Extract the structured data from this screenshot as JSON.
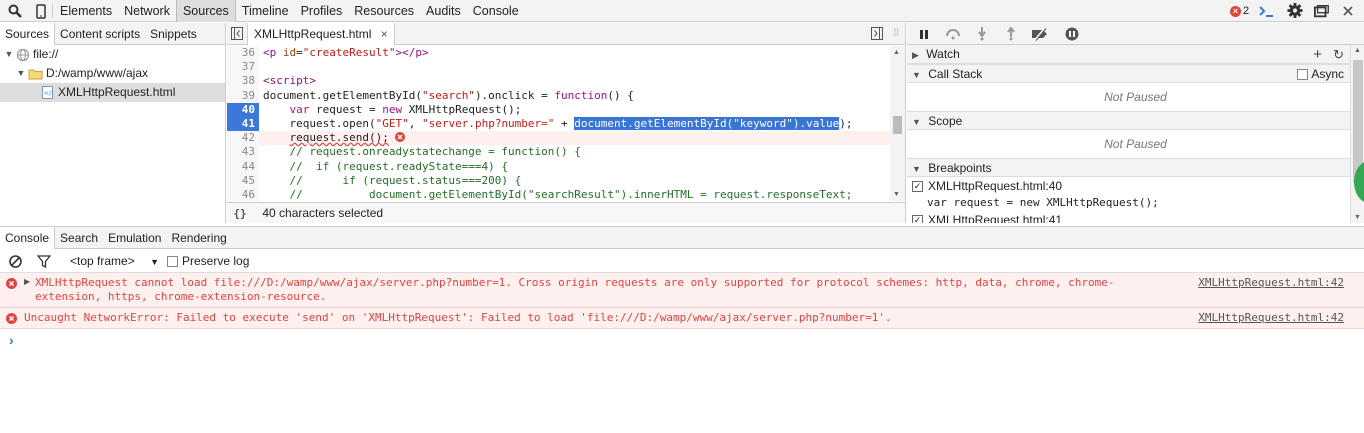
{
  "toolbar": {
    "tabs": [
      "Elements",
      "Network",
      "Sources",
      "Timeline",
      "Profiles",
      "Resources",
      "Audits",
      "Console"
    ],
    "error_count": "2"
  },
  "navigator": {
    "tabs": [
      "Sources",
      "Content scripts",
      "Snippets"
    ],
    "tree": [
      "file://",
      "D:/wamp/www/ajax",
      "XMLHttpRequest.html"
    ]
  },
  "editor": {
    "file_tab": "XMLHttpRequest.html",
    "status": "40 characters selected",
    "status_icon": "{}",
    "lines": [
      {
        "n": "36",
        "text": "<p id=\"createResult\"></p>"
      },
      {
        "n": "37",
        "text": ""
      },
      {
        "n": "38",
        "text": "<script>"
      },
      {
        "n": "39",
        "text": "document.getElementById(\"search\").onclick = function() {"
      },
      {
        "n": "40",
        "text": "    var request = new XMLHttpRequest();"
      },
      {
        "n": "41",
        "text": "    request.open(\"GET\", \"server.php?number=\" + document.getElementById(\"keyword\").value);"
      },
      {
        "n": "42",
        "text": "    request.send();"
      },
      {
        "n": "43",
        "text": "    // request.onreadystatechange = function() {"
      },
      {
        "n": "44",
        "text": "    //  if (request.readyState===4) {"
      },
      {
        "n": "45",
        "text": "    //      if (request.status===200) {"
      },
      {
        "n": "46",
        "text": "    //          document.getElementById(\"searchResult\").innerHTML = request.responseText;"
      }
    ]
  },
  "debugger": {
    "watch": "Watch",
    "call_stack": "Call Stack",
    "async": "Async",
    "not_paused": "Not Paused",
    "scope": "Scope",
    "breakpoints": "Breakpoints",
    "bp_file": "XMLHttpRequest.html:40",
    "bp_code": "var request = new XMLHttpRequest();",
    "bp_file2": "XMLHttpRequest.html:41"
  },
  "drawer": {
    "tabs": [
      "Console",
      "Search",
      "Emulation",
      "Rendering"
    ],
    "frame": "<top frame>",
    "preserve_log": "Preserve log",
    "messages": [
      {
        "text": "XMLHttpRequest cannot load file:///D:/wamp/www/ajax/server.php?number=1. Cross origin requests are only supported for protocol schemes: http, data, chrome, chrome-extension, https, chrome-extension-resource.",
        "link": "XMLHttpRequest.html:42"
      },
      {
        "text": "Uncaught NetworkError: Failed to execute 'send' on 'XMLHttpRequest': Failed to load 'file:///D:/wamp/www/ajax/server.php?number=1'.",
        "link": "XMLHttpRequest.html:42"
      }
    ],
    "prompt": "›"
  },
  "colors": {
    "error": "#e0443e",
    "breakpoint": "#3c78d8",
    "selection": "#3875d7"
  }
}
